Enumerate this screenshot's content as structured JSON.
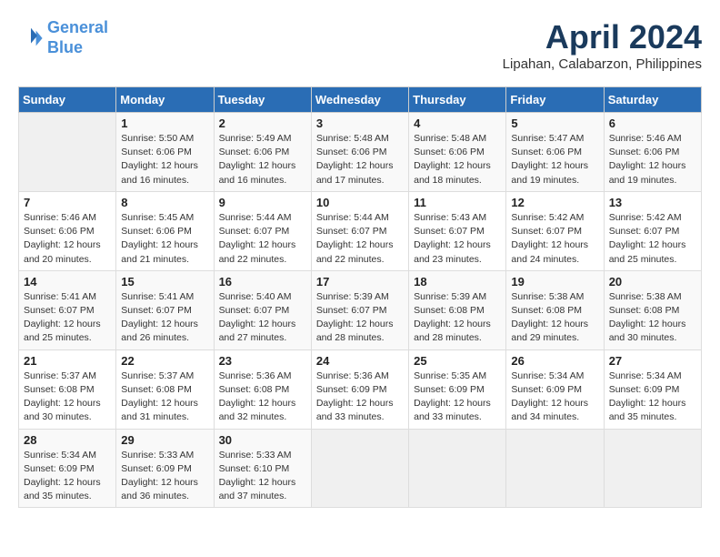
{
  "header": {
    "logo_line1": "General",
    "logo_line2": "Blue",
    "title": "April 2024",
    "subtitle": "Lipahan, Calabarzon, Philippines"
  },
  "calendar": {
    "days_of_week": [
      "Sunday",
      "Monday",
      "Tuesday",
      "Wednesday",
      "Thursday",
      "Friday",
      "Saturday"
    ],
    "weeks": [
      [
        {
          "day": "",
          "info": ""
        },
        {
          "day": "1",
          "info": "Sunrise: 5:50 AM\nSunset: 6:06 PM\nDaylight: 12 hours\nand 16 minutes."
        },
        {
          "day": "2",
          "info": "Sunrise: 5:49 AM\nSunset: 6:06 PM\nDaylight: 12 hours\nand 16 minutes."
        },
        {
          "day": "3",
          "info": "Sunrise: 5:48 AM\nSunset: 6:06 PM\nDaylight: 12 hours\nand 17 minutes."
        },
        {
          "day": "4",
          "info": "Sunrise: 5:48 AM\nSunset: 6:06 PM\nDaylight: 12 hours\nand 18 minutes."
        },
        {
          "day": "5",
          "info": "Sunrise: 5:47 AM\nSunset: 6:06 PM\nDaylight: 12 hours\nand 19 minutes."
        },
        {
          "day": "6",
          "info": "Sunrise: 5:46 AM\nSunset: 6:06 PM\nDaylight: 12 hours\nand 19 minutes."
        }
      ],
      [
        {
          "day": "7",
          "info": "Sunrise: 5:46 AM\nSunset: 6:06 PM\nDaylight: 12 hours\nand 20 minutes."
        },
        {
          "day": "8",
          "info": "Sunrise: 5:45 AM\nSunset: 6:06 PM\nDaylight: 12 hours\nand 21 minutes."
        },
        {
          "day": "9",
          "info": "Sunrise: 5:44 AM\nSunset: 6:07 PM\nDaylight: 12 hours\nand 22 minutes."
        },
        {
          "day": "10",
          "info": "Sunrise: 5:44 AM\nSunset: 6:07 PM\nDaylight: 12 hours\nand 22 minutes."
        },
        {
          "day": "11",
          "info": "Sunrise: 5:43 AM\nSunset: 6:07 PM\nDaylight: 12 hours\nand 23 minutes."
        },
        {
          "day": "12",
          "info": "Sunrise: 5:42 AM\nSunset: 6:07 PM\nDaylight: 12 hours\nand 24 minutes."
        },
        {
          "day": "13",
          "info": "Sunrise: 5:42 AM\nSunset: 6:07 PM\nDaylight: 12 hours\nand 25 minutes."
        }
      ],
      [
        {
          "day": "14",
          "info": "Sunrise: 5:41 AM\nSunset: 6:07 PM\nDaylight: 12 hours\nand 25 minutes."
        },
        {
          "day": "15",
          "info": "Sunrise: 5:41 AM\nSunset: 6:07 PM\nDaylight: 12 hours\nand 26 minutes."
        },
        {
          "day": "16",
          "info": "Sunrise: 5:40 AM\nSunset: 6:07 PM\nDaylight: 12 hours\nand 27 minutes."
        },
        {
          "day": "17",
          "info": "Sunrise: 5:39 AM\nSunset: 6:07 PM\nDaylight: 12 hours\nand 28 minutes."
        },
        {
          "day": "18",
          "info": "Sunrise: 5:39 AM\nSunset: 6:08 PM\nDaylight: 12 hours\nand 28 minutes."
        },
        {
          "day": "19",
          "info": "Sunrise: 5:38 AM\nSunset: 6:08 PM\nDaylight: 12 hours\nand 29 minutes."
        },
        {
          "day": "20",
          "info": "Sunrise: 5:38 AM\nSunset: 6:08 PM\nDaylight: 12 hours\nand 30 minutes."
        }
      ],
      [
        {
          "day": "21",
          "info": "Sunrise: 5:37 AM\nSunset: 6:08 PM\nDaylight: 12 hours\nand 30 minutes."
        },
        {
          "day": "22",
          "info": "Sunrise: 5:37 AM\nSunset: 6:08 PM\nDaylight: 12 hours\nand 31 minutes."
        },
        {
          "day": "23",
          "info": "Sunrise: 5:36 AM\nSunset: 6:08 PM\nDaylight: 12 hours\nand 32 minutes."
        },
        {
          "day": "24",
          "info": "Sunrise: 5:36 AM\nSunset: 6:09 PM\nDaylight: 12 hours\nand 33 minutes."
        },
        {
          "day": "25",
          "info": "Sunrise: 5:35 AM\nSunset: 6:09 PM\nDaylight: 12 hours\nand 33 minutes."
        },
        {
          "day": "26",
          "info": "Sunrise: 5:34 AM\nSunset: 6:09 PM\nDaylight: 12 hours\nand 34 minutes."
        },
        {
          "day": "27",
          "info": "Sunrise: 5:34 AM\nSunset: 6:09 PM\nDaylight: 12 hours\nand 35 minutes."
        }
      ],
      [
        {
          "day": "28",
          "info": "Sunrise: 5:34 AM\nSunset: 6:09 PM\nDaylight: 12 hours\nand 35 minutes."
        },
        {
          "day": "29",
          "info": "Sunrise: 5:33 AM\nSunset: 6:09 PM\nDaylight: 12 hours\nand 36 minutes."
        },
        {
          "day": "30",
          "info": "Sunrise: 5:33 AM\nSunset: 6:10 PM\nDaylight: 12 hours\nand 37 minutes."
        },
        {
          "day": "",
          "info": ""
        },
        {
          "day": "",
          "info": ""
        },
        {
          "day": "",
          "info": ""
        },
        {
          "day": "",
          "info": ""
        }
      ]
    ]
  }
}
